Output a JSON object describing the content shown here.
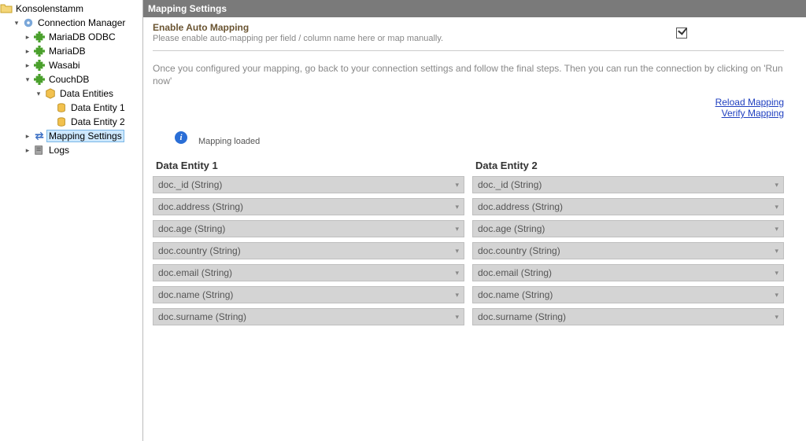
{
  "tree": {
    "root_label": "Konsolenstamm",
    "conn_mgr_label": "Connection Manager",
    "items": [
      {
        "label": "MariaDB ODBC"
      },
      {
        "label": "MariaDB"
      },
      {
        "label": "Wasabi"
      },
      {
        "label": "CouchDB"
      }
    ],
    "data_entities_label": "Data Entities",
    "entities": [
      {
        "label": "Data Entity 1"
      },
      {
        "label": "Data Entity 2"
      }
    ],
    "mapping_settings_label": "Mapping Settings",
    "logs_label": "Logs"
  },
  "panel": {
    "title": "Mapping Settings",
    "auto_map_title": "Enable Auto Mapping",
    "auto_map_desc": "Please enable auto-mapping per field / column name here or map manually.",
    "auto_map_checked": true,
    "instruction": "Once you configured your mapping, go back to your connection settings and follow the final steps. Then you can run the connection by clicking on 'Run now'",
    "link_reload": "Reload Mapping",
    "link_verify": "Verify Mapping",
    "status_text": "Mapping loaded",
    "col1_header": "Data Entity 1",
    "col2_header": "Data Entity 2",
    "rows": [
      {
        "left": "doc._id (String)",
        "right": "doc._id (String)"
      },
      {
        "left": "doc.address (String)",
        "right": "doc.address (String)"
      },
      {
        "left": "doc.age (String)",
        "right": "doc.age (String)"
      },
      {
        "left": "doc.country (String)",
        "right": "doc.country (String)"
      },
      {
        "left": "doc.email (String)",
        "right": "doc.email (String)"
      },
      {
        "left": "doc.name (String)",
        "right": "doc.name (String)"
      },
      {
        "left": "doc.surname (String)",
        "right": "doc.surname (String)"
      }
    ]
  }
}
